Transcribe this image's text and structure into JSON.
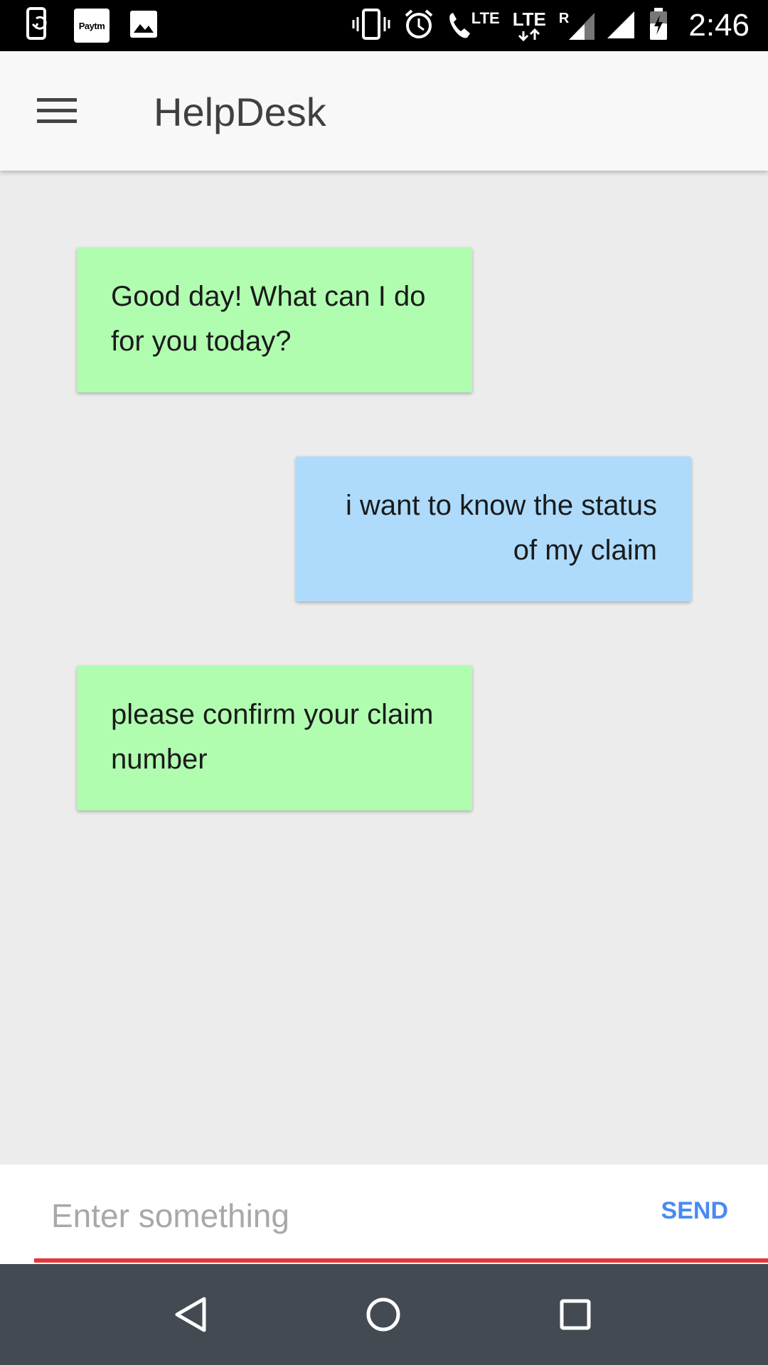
{
  "status_bar": {
    "time": "2:46",
    "left_icons": [
      "sync-phone-icon",
      "paytm-icon",
      "image-icon"
    ],
    "paytm_label": "Paytm",
    "right_icons": [
      "vibrate-icon",
      "alarm-icon",
      "volte-call-icon",
      "lte-data-icon",
      "signal-roaming-icon",
      "signal-icon",
      "battery-charging-icon"
    ],
    "volte_label": "LTE",
    "lte_label": "LTE",
    "roaming_label": "R"
  },
  "app_bar": {
    "title": "HelpDesk",
    "menu_icon": "hamburger-menu-icon"
  },
  "messages": [
    {
      "sender": "bot",
      "text": "Good day! What can I do for you today?"
    },
    {
      "sender": "user",
      "text": "i want to know the status of my claim"
    },
    {
      "sender": "bot",
      "text": "please confirm your claim number"
    }
  ],
  "input": {
    "placeholder": "Enter something",
    "value": "",
    "send_label": "SEND"
  },
  "colors": {
    "bot_bubble": "#b0fdb0",
    "user_bubble": "#aedbfc",
    "accent_send": "#4a8af0",
    "input_underline": "#e8353b",
    "navbar": "#434a52"
  },
  "nav_bar": {
    "icons": [
      "back-icon",
      "home-icon",
      "recents-icon"
    ]
  }
}
